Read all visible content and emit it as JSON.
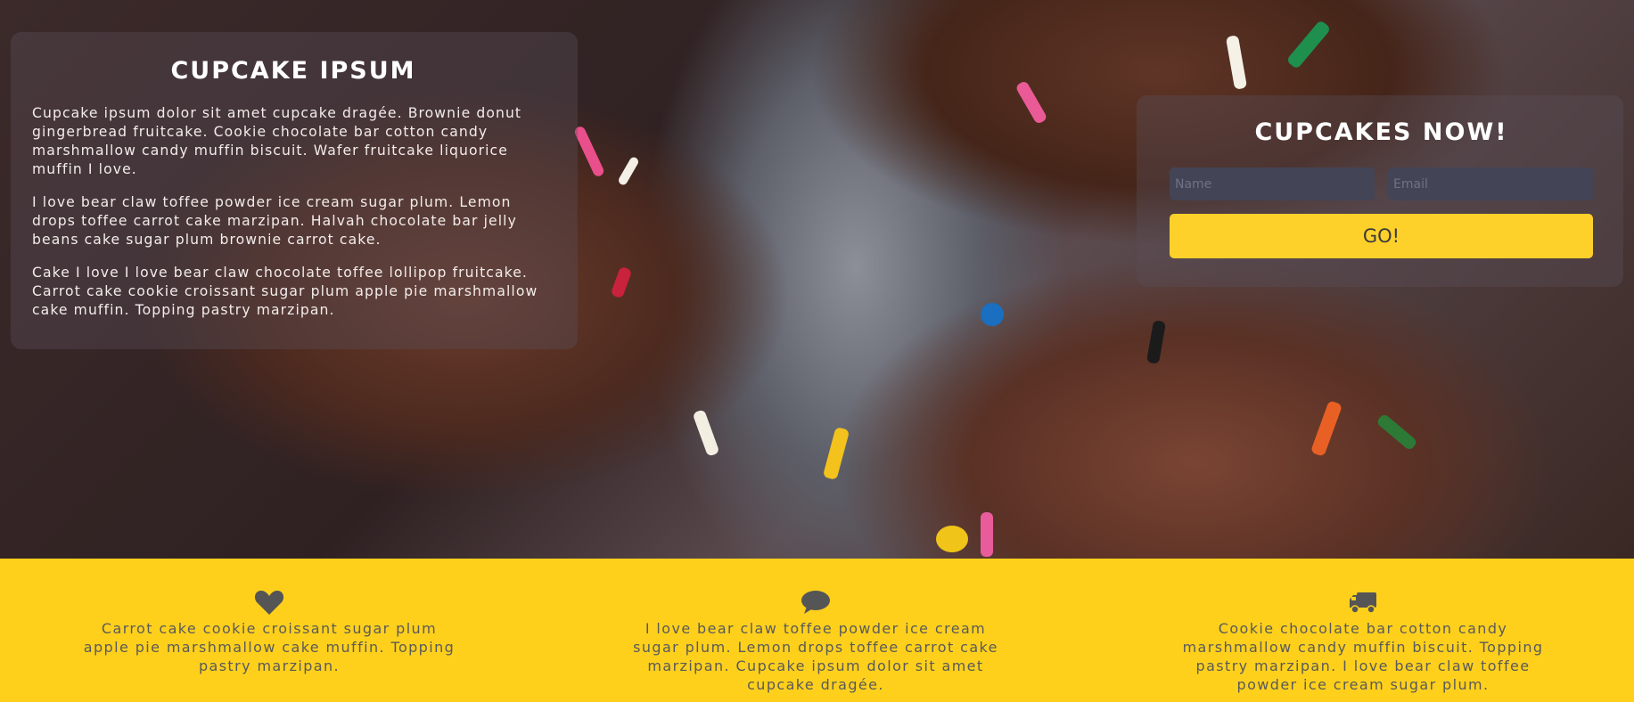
{
  "left_panel": {
    "title": "CUPCAKE IPSUM",
    "paragraphs": [
      "Cupcake ipsum dolor sit amet cupcake dragée. Brownie donut gingerbread fruitcake. Cookie chocolate bar cotton candy marshmallow candy muffin biscuit. Wafer fruitcake liquorice muffin I love.",
      "I love bear claw toffee powder ice cream sugar plum. Lemon drops toffee carrot cake marzipan. Halvah chocolate bar jelly beans cake sugar plum brownie carrot cake.",
      "Cake I love I love bear claw chocolate toffee lollipop fruitcake. Carrot cake cookie croissant sugar plum apple pie marshmallow cake muffin. Topping pastry marzipan."
    ]
  },
  "signup": {
    "title": "CUPCAKES NOW!",
    "name_placeholder": "Name",
    "email_placeholder": "Email",
    "go_label": "GO!"
  },
  "features": [
    {
      "icon": "heart-icon",
      "text": "Carrot cake cookie croissant sugar plum apple pie marshmallow cake muffin. Topping pastry marzipan."
    },
    {
      "icon": "comment-icon",
      "text": "I love bear claw toffee powder ice cream sugar plum. Lemon drops toffee carrot cake marzipan. Cupcake ipsum dolor sit amet cupcake dragée."
    },
    {
      "icon": "truck-icon",
      "text": "Cookie chocolate bar cotton candy marshmallow candy muffin biscuit. Topping pastry marzipan. I love bear claw toffee powder ice cream sugar plum."
    }
  ],
  "colors": {
    "accent_yellow": "#fed01c",
    "button_yellow": "#fed02a",
    "icon_gray": "#555555"
  }
}
